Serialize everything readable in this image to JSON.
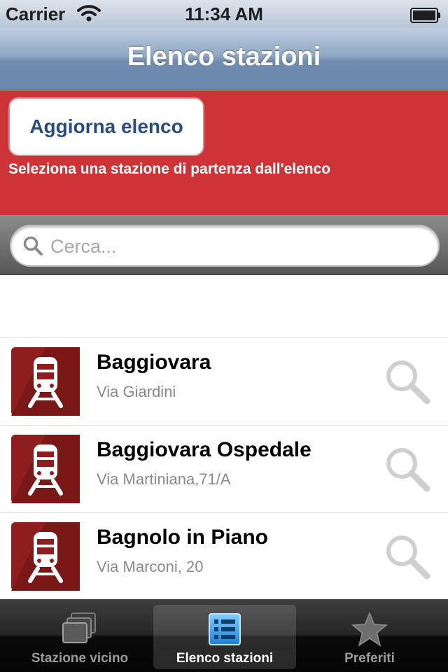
{
  "status_bar": {
    "carrier": "Carrier",
    "time": "11:34 AM",
    "wifi_icon": "wifi-icon",
    "battery_icon": "battery-icon"
  },
  "nav_bar": {
    "title": "Elenco stazioni"
  },
  "toolbar": {
    "refresh_label": "Aggiorna elenco",
    "hint": "Seleziona una stazione di partenza dall'elenco",
    "accent_color": "#cc3438"
  },
  "search": {
    "placeholder": "Cerca...",
    "value": "",
    "icon": "search-icon"
  },
  "stations": [
    {
      "name": "Baggiovara",
      "address": "Via Giardini",
      "icon": "train-icon"
    },
    {
      "name": "Baggiovara Ospedale",
      "address": "Via Martiniana,71/A",
      "icon": "train-icon"
    },
    {
      "name": "Bagnolo in Piano",
      "address": "Via Marconi, 20",
      "icon": "train-icon"
    }
  ],
  "tab_bar": {
    "tabs": [
      {
        "label": "Stazione vicino",
        "icon": "photo-stack-icon",
        "selected": false
      },
      {
        "label": "Elenco stazioni",
        "icon": "list-icon",
        "selected": true
      },
      {
        "label": "Preferiti",
        "icon": "star-icon",
        "selected": false
      }
    ]
  }
}
